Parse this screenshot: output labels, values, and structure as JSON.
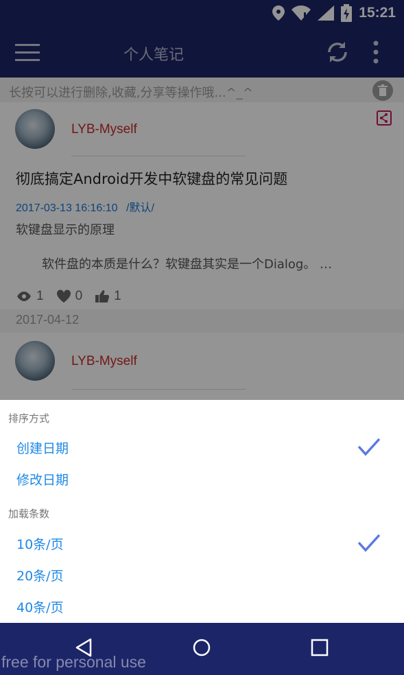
{
  "status_bar": {
    "time": "15:21",
    "icons": [
      "location-icon",
      "wifi-icon",
      "signal-icon",
      "battery-icon"
    ]
  },
  "toolbar": {
    "title": "个人笔记",
    "icons": [
      "menu-icon",
      "refresh-icon",
      "more-icon"
    ]
  },
  "hint": {
    "text": "长按可以进行删除,收藏,分享等操作哦...^_^",
    "icon": "trash-icon"
  },
  "notes": [
    {
      "author": "LYB-Myself",
      "title": "彻底搞定Android开发中软键盘的常见问题",
      "date": "2017-03-13 16:16:10",
      "category": "/默认/",
      "summary": "软键盘显示的原理",
      "excerpt": "软件盘的本质是什么？软键盘其实是一个Dialog。 …",
      "stats": {
        "views": "1",
        "likes": "0",
        "thumbs": "1"
      }
    },
    {
      "date_separator": "2017-04-12",
      "author": "LYB-Myself"
    }
  ],
  "sheet": {
    "sort_title": "排序方式",
    "sort_options": [
      {
        "label": "创建日期",
        "checked": true
      },
      {
        "label": "修改日期",
        "checked": false
      }
    ],
    "load_title": "加载条数",
    "load_options": [
      {
        "label": "10条/页",
        "checked": true
      },
      {
        "label": "20条/页",
        "checked": false
      },
      {
        "label": "40条/页",
        "checked": false
      }
    ]
  },
  "nav_bar": {
    "icons": [
      "back-icon",
      "home-icon",
      "recents-icon"
    ]
  },
  "watermark": "free for personal use",
  "colors": {
    "primary": "#1c2568",
    "accent": "#1e88e5",
    "check": "#5c7ae0",
    "author": "#c62828"
  }
}
